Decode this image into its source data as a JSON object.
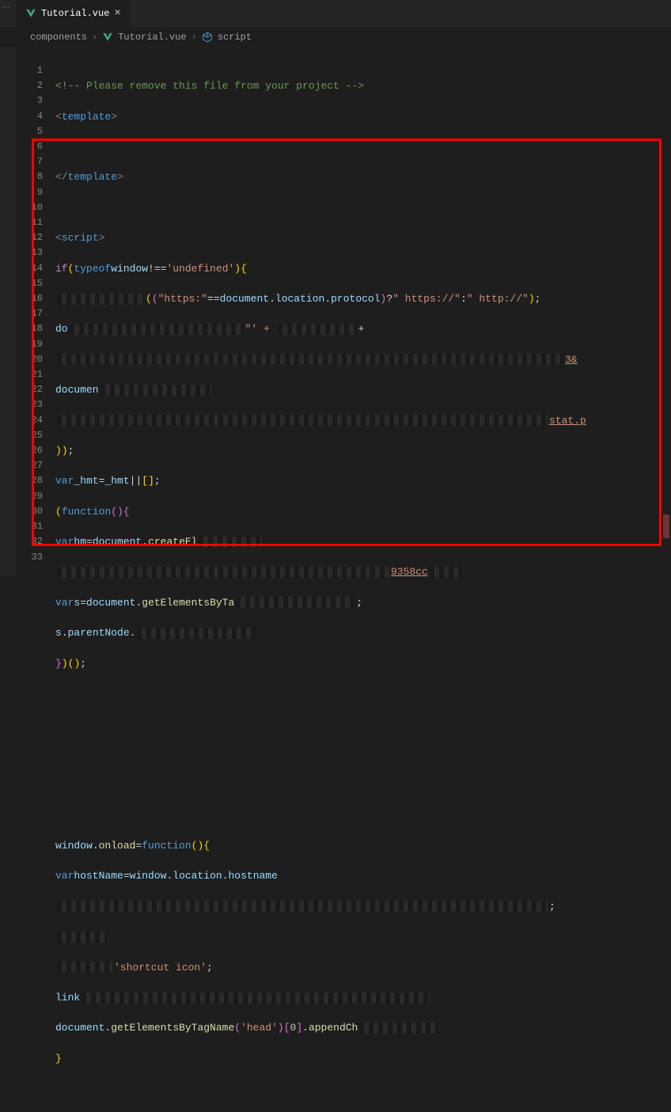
{
  "tab": {
    "filename": "Tutorial.vue",
    "close": "×"
  },
  "breadcrumb": {
    "part1": "components",
    "part2": "Tutorial.vue",
    "part3": "script",
    "sep": "›"
  },
  "lineNumbers": [
    "1",
    "2",
    "3",
    "4",
    "5",
    "6",
    "7",
    "8",
    "9",
    "10",
    "11",
    "12",
    "13",
    "14",
    "15",
    "16",
    "17",
    "18",
    "19",
    "20",
    "21",
    "22",
    "23",
    "24",
    "25",
    "26",
    "27",
    "28",
    "29",
    "30",
    "31",
    "32",
    "33"
  ],
  "code": {
    "l1_comment": "<!-- Please remove this file from your project -->",
    "l2_template_open": "template",
    "l4_template_close": "template",
    "l6_script": "script",
    "l7": {
      "if": "if",
      "typeof": "typeof",
      "window": "window",
      "neq": "!==",
      "str": "'undefined'"
    },
    "l8": {
      "https": "\"https:\"",
      "eq": "==",
      "doc": "document",
      "loc": "location",
      "proto": "protocol",
      "q": "?",
      "s1": "\" https://\"",
      "colon": ":",
      "s2": "\" http://\""
    },
    "l9": {
      "pre": "do",
      "plus": "+",
      "mid": "\"' + "
    },
    "l10_tail": "3&",
    "l11": {
      "doc": "documen"
    },
    "l12_stat": "stat.p",
    "l14": {
      "varkw": "var",
      "name": "_hmt",
      "eq": "=",
      "rhs": "_hmt",
      "or": "||",
      "arr": "[]"
    },
    "l15": {
      "fn": "function"
    },
    "l16": {
      "varkw": "var",
      "hm": "hm",
      "eq": "=",
      "doc": "document",
      "create": "createEl"
    },
    "l17_tail": "9358cc",
    "l18": {
      "varkw": "var",
      "s": "s",
      "eq": "=",
      "doc": "document",
      "get": "getElementsByTa"
    },
    "l19": {
      "s": "s",
      "pnode": "parentNode"
    },
    "l26": {
      "win": "window",
      "onload": "onload",
      "eq": "=",
      "fn": "function"
    },
    "l27": {
      "varkw": "var",
      "hn": "hostName",
      "eq": "=",
      "win": "window",
      "loc": "location",
      "host": "hostname"
    },
    "l28_tail": ";",
    "l30_str": "'shortcut icon'",
    "l31_link": "link",
    "l32": {
      "doc": "document",
      "get": "getElementsByTagName",
      "head": "'head'",
      "idx": "0",
      "append": "appendCh"
    }
  }
}
